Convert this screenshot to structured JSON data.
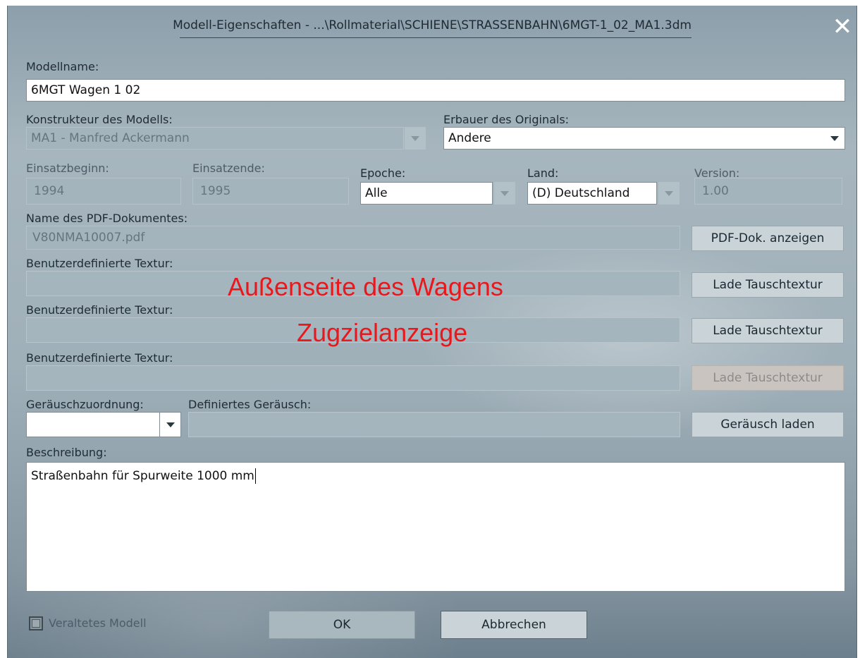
{
  "dialog": {
    "title": "Modell-Eigenschaften - ...\\Rollmaterial\\SCHIENE\\STRASSENBAHN\\6MGT-1_02_MA1.3dm",
    "close_symbol": "✕"
  },
  "model_name": {
    "label": "Modellname:",
    "value": "6MGT Wagen 1 02"
  },
  "designer": {
    "label": "Konstrukteur des Modells:",
    "value": "MA1 - Manfred Ackermann"
  },
  "manufacturer": {
    "label": "Erbauer des Originals:",
    "value": "Andere"
  },
  "service_start": {
    "label": "Einsatzbeginn:",
    "value": "1994"
  },
  "service_end": {
    "label": "Einsatzende:",
    "value": "1995"
  },
  "epoch": {
    "label": "Epoche:",
    "value": "Alle"
  },
  "country": {
    "label": "Land:",
    "value": "(D) Deutschland"
  },
  "version": {
    "label": "Version:",
    "value": "1.00"
  },
  "pdf": {
    "label": "Name des PDF-Dokumentes:",
    "value": "V80NMA10007.pdf",
    "button": "PDF-Dok. anzeigen"
  },
  "textures": [
    {
      "label": "Benutzerdefinierte Textur:",
      "button": "Lade Tauschtextur",
      "overlay": "Außenseite des Wagens"
    },
    {
      "label": "Benutzerdefinierte Textur:",
      "button": "Lade Tauschtextur",
      "overlay": "Zugzielanzeige"
    },
    {
      "label": "Benutzerdefinierte Textur:",
      "button": "Lade Tauschtextur",
      "overlay": ""
    }
  ],
  "sound": {
    "assignment_label": "Geräuschzuordnung:",
    "defined_label": "Definiertes Geräusch:",
    "button": "Geräusch laden"
  },
  "description": {
    "label": "Beschreibung:",
    "value": "Straßenbahn für Spurweite 1000 mm"
  },
  "obsolete": {
    "label": "Veraltetes Modell"
  },
  "buttons": {
    "ok": "OK",
    "cancel": "Abbrechen"
  },
  "colors": {
    "overlay_text": "#e8181c",
    "dialog_bg": "#a0b0b9"
  }
}
